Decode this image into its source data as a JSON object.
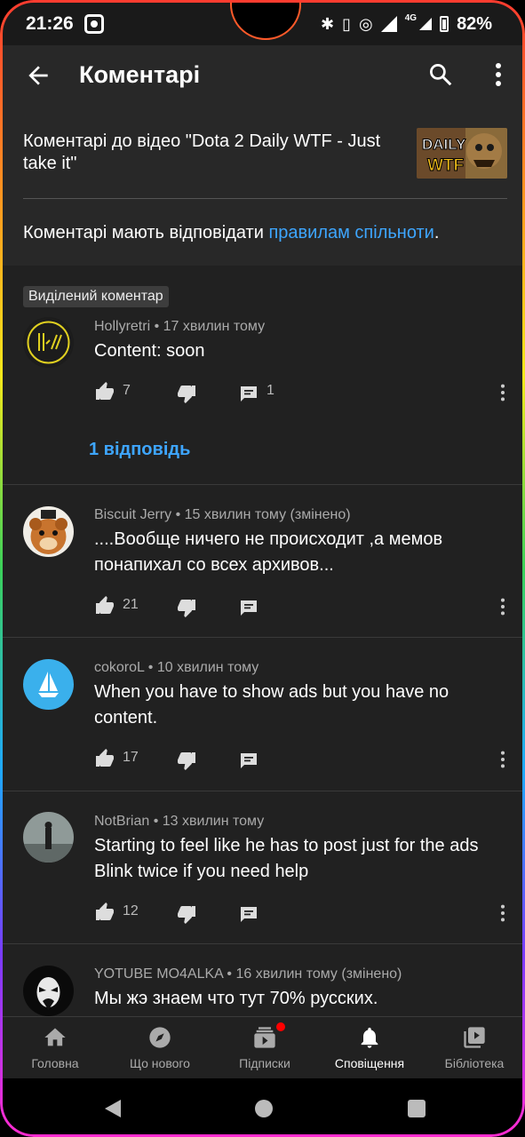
{
  "status_bar": {
    "time": "21:26",
    "network": "4G",
    "battery": "82%"
  },
  "app_bar": {
    "title": "Коментарі",
    "icons": [
      "back-arrow-icon",
      "search-icon",
      "more-vert-icon"
    ]
  },
  "header": {
    "video_caption": "Коментарі до відео \"Dota 2 Daily WTF - Just take it\"",
    "thumbnail_label_1": "DAILY",
    "thumbnail_label_2": "WTF",
    "rules_prefix": "Коментарі мають відповідати ",
    "rules_link": "правилам спільноти",
    "rules_suffix": "."
  },
  "comments": [
    {
      "badge": "Виділений коментар",
      "author": "Hollyretri",
      "time": "17 хвилин тому",
      "text": "Content: soon",
      "likes": "7",
      "replies": "1",
      "replies_link": "1 відповідь"
    },
    {
      "author": "Biscuit Jerry",
      "time": "15 хвилин тому (змінено)",
      "text": "....Вообще ничего не происходит ,а мемов понапихал со всех архивов...",
      "likes": "21"
    },
    {
      "author": "cokoroL",
      "time": "10 хвилин тому",
      "text": "When you have to show ads but you have no content.",
      "likes": "17"
    },
    {
      "author": "NotBrian",
      "time": "13 хвилин тому",
      "text": "Starting to feel like he has to post just for the ads Blink twice if you need help",
      "likes": "12"
    },
    {
      "author": "YOTUBE MO4ALKA",
      "time": "16 хвилин тому (змінено)",
      "text": "Мы жэ знаем что тут 70% русских."
    }
  ],
  "meta_separator": "•",
  "bottom_nav": [
    {
      "label": "Головна",
      "icon": "home-icon"
    },
    {
      "label": "Що нового",
      "icon": "explore-icon"
    },
    {
      "label": "Підписки",
      "icon": "subscriptions-icon"
    },
    {
      "label": "Сповіщення",
      "icon": "bell-icon"
    },
    {
      "label": "Бібліотека",
      "icon": "library-icon"
    }
  ],
  "colors": {
    "background": "#212121",
    "panel": "#282828",
    "link": "#3ea6ff",
    "meta": "#aaaaaa"
  }
}
